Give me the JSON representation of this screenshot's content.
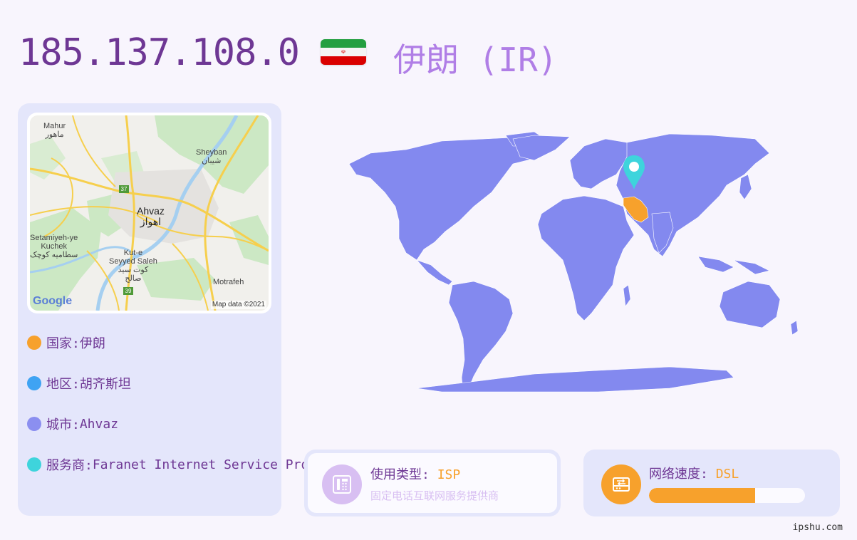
{
  "header": {
    "ip": "185.137.108.0",
    "country_name": "伊朗 (IR)",
    "flag_icon": "iran-flag-icon"
  },
  "map": {
    "labels": {
      "mahur": "Mahur",
      "mahur_ar": "ماهور",
      "sheyban": "Sheyban",
      "sheyban_ar": "شيبان",
      "ahvaz": "Ahvaz",
      "ahvaz_ar": "اهواز",
      "setamiyeh": "Setamiyeh-ye",
      "kuchek": "Kuchek",
      "setamiyeh_ar": "سطامیه کوچک",
      "kute": "Kut-e",
      "seyyed": "Seyyed Saleh",
      "kute_ar": "کوت سید",
      "saleh_ar": "صالح",
      "motrafeh": "Motrafeh",
      "road37": "37",
      "road39": "39",
      "attribution": "Map data ©2021",
      "logo": "Google"
    }
  },
  "info": [
    {
      "label": "国家: ",
      "value": "伊朗",
      "color": "#f7a12c"
    },
    {
      "label": "地区: ",
      "value": "胡齐斯坦",
      "color": "#3fa3f3"
    },
    {
      "label": "城市: ",
      "value": "Ahvaz",
      "color": "#8b8ff0"
    },
    {
      "label": "服务商: ",
      "value": "Faranet Internet Service Provider",
      "color": "#3ed4dc"
    }
  ],
  "usage": {
    "title": "使用类型: ",
    "value": "ISP",
    "subtitle": "固定电话互联网服务提供商",
    "icon": "phone-icon"
  },
  "speed": {
    "title": "网络速度: ",
    "value": "DSL",
    "progress": 0.68,
    "icon": "router-icon"
  },
  "footer": {
    "site": "ipshu.com"
  },
  "colors": {
    "accent": "#f7a12c",
    "purple": "#6e3794",
    "world": "#8389ef"
  }
}
